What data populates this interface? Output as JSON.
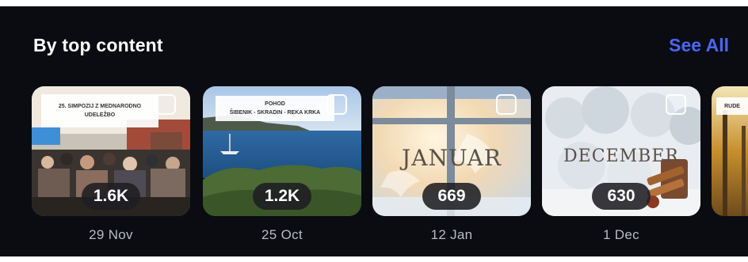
{
  "section": {
    "title": "By top content",
    "see_all_label": "See All"
  },
  "cards": [
    {
      "count": "1.6K",
      "date": "29 Nov",
      "caption_line1": "25. SIMPOZIJ Z MEDNARODNO",
      "caption_line2": "UDELEŽBO"
    },
    {
      "count": "1.2K",
      "date": "25 Oct",
      "caption_line1": "POHOD",
      "caption_line2": "ŠIBENIK - SKRADIN - REKA KRKA"
    },
    {
      "count": "669",
      "date": "12 Jan",
      "overlay_word": "JANUAR"
    },
    {
      "count": "630",
      "date": "1 Dec",
      "overlay_word": "DECEMBER"
    },
    {
      "caption_fragment": "RUDE"
    }
  ]
}
